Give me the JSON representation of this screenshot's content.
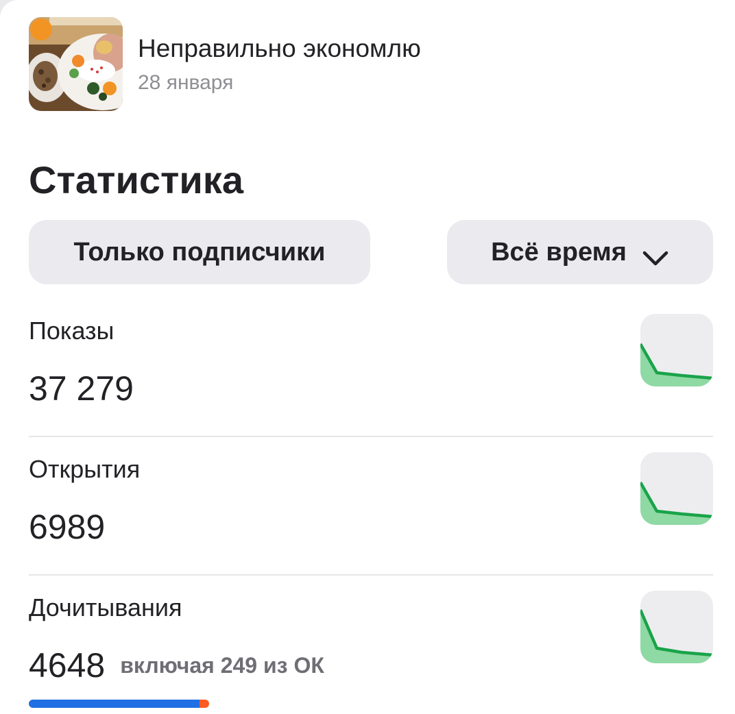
{
  "article": {
    "title": "Неправильно экономлю",
    "date": "28 января",
    "thumbnail_icon": "food-plate-photo"
  },
  "section_title": "Статистика",
  "filters": {
    "audience_label": "Только подписчики",
    "period_label": "Всё время",
    "period_icon": "chevron-down-icon"
  },
  "stats": [
    {
      "label": "Показы",
      "value": "37 279",
      "trend_icon": "sparkline-declining"
    },
    {
      "label": "Открытия",
      "value": "6989",
      "trend_icon": "sparkline-declining"
    },
    {
      "label": "Дочитывания",
      "value": "4648",
      "extra": "включая 249 из ОК",
      "trend_icon": "sparkline-declining"
    }
  ],
  "reads_breakdown": {
    "total": 4648,
    "ok": 249,
    "colors": {
      "main": "#1f6fe5",
      "ok": "#ff5a1f"
    }
  },
  "colors": {
    "accent_green": "#1aa34a",
    "chip_bg": "#ebebef",
    "text": "#222226",
    "muted": "#8e8e93"
  }
}
